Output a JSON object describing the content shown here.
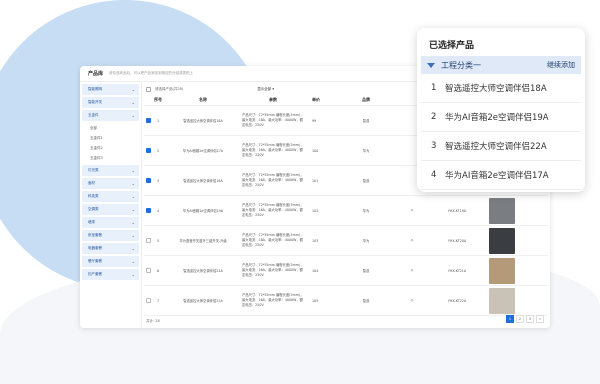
{
  "header": {
    "title": "产品库",
    "subtitle": "请勾选商品后，可以把产品添加到相应的分组或类别上"
  },
  "sidebar": {
    "items": [
      {
        "label": "智能照明"
      },
      {
        "label": "智能开关"
      },
      {
        "label": "五金件",
        "children": [
          "全部",
          "五金件1",
          "五金件2",
          "五金件3"
        ]
      },
      {
        "label": "灯光类"
      },
      {
        "label": "面材"
      },
      {
        "label": "科技类"
      },
      {
        "label": "空调类"
      },
      {
        "label": "墙漆"
      },
      {
        "label": "卧室套餐"
      },
      {
        "label": "电器套餐"
      },
      {
        "label": "餐厅套餐"
      },
      {
        "label": "妇产套餐"
      }
    ]
  },
  "toolbar": {
    "select_all": "请选择产品(共28)",
    "filter": "显示全部"
  },
  "table": {
    "headers": [
      "序号",
      "名称",
      "参数",
      "单价",
      "品牌"
    ],
    "rows": [
      {
        "checked": true,
        "no": "1",
        "name": "智选遥控大师空调伴侣18A",
        "params": "产品尺寸：72*55mm 编程长度(5mm)，最大电流：16A，最大功率：4000W，额定电压：250V",
        "price": "99",
        "brand": "智选",
        "unit": "",
        "model": "",
        "image": false
      },
      {
        "checked": true,
        "no": "2",
        "name": "华为AI音箱2e空调伴侣17A",
        "params": "产品尺寸：72*55mm 编程长度(5mm)，最大电流：16A，最大功率：4000W，额定电压：220V",
        "price": "100",
        "brand": "华为",
        "unit": "",
        "model": "",
        "image": false
      },
      {
        "checked": true,
        "no": "3",
        "name": "智选遥控大师空调伴侣18A",
        "params": "产品尺寸：72*55mm 编程长度(5mm)，最大电流：16A，最大功率：4000W，额定电压：250V",
        "price": "101",
        "brand": "智选",
        "unit": "",
        "model": "",
        "image": false
      },
      {
        "checked": true,
        "no": "4",
        "name": "华为AI音箱2e空调伴侣19A",
        "params": "产品尺寸：72*55mm 编程长度(5mm)，最大电流：16A，最大功率：4000W，额定电压：250V",
        "price": "102",
        "brand": "华为",
        "unit": "个",
        "model": "YHX-KT19A",
        "image": true,
        "img_color": "#7a7d82"
      },
      {
        "checked": false,
        "no": "5",
        "name": "华为语音开关蓝牙三键开关-升级",
        "params": "产品尺寸：72*55mm 编程长度(5mm)，最大电流：16A，最大功率：4000W，额定电压：250V",
        "price": "103",
        "brand": "华为",
        "unit": "个",
        "model": "YHX-KT20A",
        "image": true,
        "img_color": "#3a3d42"
      },
      {
        "checked": false,
        "no": "6",
        "name": "智选遥控大师空调伴侣21A",
        "params": "产品尺寸：72*55mm 编程长度(5mm)，最大电流：16A，最大功率：4000W，额定电压：250V",
        "price": "104",
        "brand": "智选",
        "unit": "个",
        "model": "YHX-KT21A",
        "image": true,
        "img_color": "#b59a7a"
      },
      {
        "checked": false,
        "no": "7",
        "name": "智选遥控大师空调伴侣22A",
        "params": "产品尺寸：72*55mm 编程长度(5mm)，最大电流：16A，最大功率：4000W，额定电压：250V",
        "price": "105",
        "brand": "智选",
        "unit": "个",
        "model": "YHX-KT22A",
        "image": true,
        "img_color": "#c9c2b6"
      }
    ]
  },
  "footer": {
    "total": "共计: 28",
    "pages": [
      "1",
      "2",
      "3",
      "»"
    ]
  },
  "panel": {
    "title": "已选择产品",
    "category": "工程分类一",
    "add_label": "继续添加",
    "items": [
      {
        "no": "1",
        "name": "智选遥控大师空调伴侣18A"
      },
      {
        "no": "2",
        "name": "华为AI音箱2e空调伴侣19A"
      },
      {
        "no": "3",
        "name": "智选遥控大师空调伴侣22A"
      },
      {
        "no": "4",
        "name": "华为AI音箱2e空调伴侣17A"
      }
    ]
  },
  "colors": {
    "accent": "#1e6fd9",
    "sidebar_bg": "#e8f0fb",
    "category_bar": "#dfe9f7"
  }
}
